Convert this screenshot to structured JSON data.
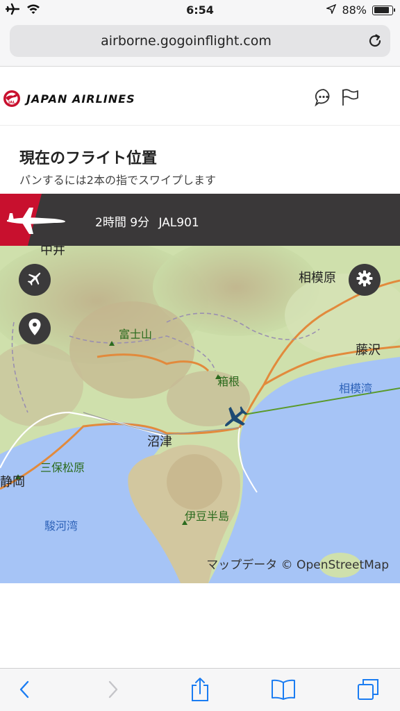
{
  "status_bar": {
    "time": "6:54",
    "battery": "88%",
    "battery_level": 0.88
  },
  "browser": {
    "url": "airborne.gogoinflight.com"
  },
  "header": {
    "airline_name": "JAPAN AIRLINES",
    "logo_text": "JAL"
  },
  "page": {
    "title": "現在のフライト位置",
    "subtitle": "パンするには2本の指でスワイプします"
  },
  "flight": {
    "time_remaining": "2時間 9分",
    "flight_number": "JAL901"
  },
  "map": {
    "labels": {
      "nakai": "中井",
      "sagamihara": "相模原",
      "fuji": "富士山",
      "fujisawa": "藤沢",
      "hakone": "箱根",
      "sagami_bay": "相模湾",
      "numazu": "沼津",
      "miho": "三保松原",
      "shizuoka": "静岡",
      "izu": "伊豆半島",
      "suruga_bay": "駿河湾"
    },
    "attribution": "マップデータ © OpenStreetMap"
  },
  "colors": {
    "jal_red": "#c8102e",
    "banner_bg": "#3a3839",
    "aircraft": "#1e4b73",
    "sea": "#a6c4f6",
    "route_line": "#5a9a2a"
  }
}
